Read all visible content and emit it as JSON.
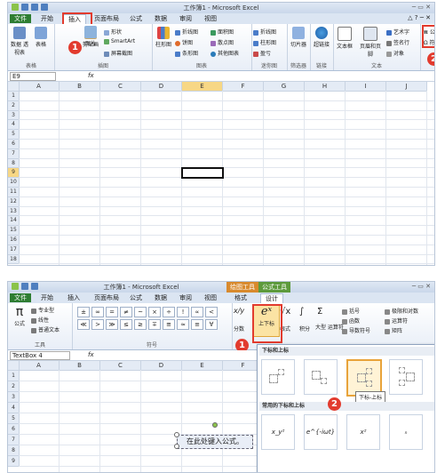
{
  "shot1": {
    "title": "工作簿1 - Microsoft Excel",
    "tabs": [
      "文件",
      "开始",
      "插入",
      "页面布局",
      "公式",
      "数据",
      "审阅",
      "视图"
    ],
    "groups": {
      "tables": {
        "label": "表格",
        "pivot": "数据\n透视表",
        "table": "表格"
      },
      "illustrations": {
        "label": "插图",
        "picture": "图片",
        "clipart": "剪贴画",
        "shapes": "形状",
        "smartart": "SmartArt",
        "screenshot": "屏幕截图"
      },
      "charts": {
        "label": "图表",
        "column": "柱形图",
        "line": "折线图",
        "pie": "饼图",
        "bar": "条形图",
        "area": "面积图",
        "scatter": "散点图",
        "other": "其他图表"
      },
      "sparklines": {
        "label": "迷你图",
        "line": "折线图",
        "column": "柱形图",
        "winloss": "盈亏"
      },
      "filter": {
        "label": "筛选器",
        "slicer": "切片器"
      },
      "links": {
        "label": "链接",
        "hyperlink": "超链接"
      },
      "text": {
        "label": "文本",
        "textbox": "文本框",
        "headerfooter": "页眉和页脚",
        "wordart": "艺术字",
        "signature": "签名行",
        "object": "对象"
      },
      "symbols": {
        "equation": "公式",
        "symbol": "符号"
      }
    },
    "namebox": "E9",
    "fx": "fx",
    "columns": [
      "A",
      "B",
      "C",
      "D",
      "E",
      "F",
      "G",
      "H",
      "I",
      "J"
    ],
    "rows": [
      "1",
      "2",
      "3",
      "4",
      "5",
      "6",
      "7",
      "8",
      "9",
      "10",
      "11",
      "12",
      "13",
      "14",
      "15",
      "16",
      "17",
      "18"
    ],
    "badge1": "1",
    "badge2": "2"
  },
  "shot2": {
    "title": "工作簿1 - Microsoft Excel",
    "context_tabs": {
      "drawing": "绘图工具",
      "equation": "公式工具"
    },
    "tabs": [
      "文件",
      "开始",
      "插入",
      "页面布局",
      "公式",
      "数据",
      "审阅",
      "视图",
      "格式",
      "设计"
    ],
    "tools": {
      "label": "工具",
      "equation": "公式",
      "professional": "专业型",
      "linear": "线性",
      "normal_text": "普通文本"
    },
    "symbols_label": "符号",
    "symbols": [
      "±",
      "∞",
      "=",
      "≠",
      "~",
      "×",
      "÷",
      "!",
      "∝",
      "<",
      "≪",
      ">",
      "≫",
      "≤",
      "≥",
      "∓",
      "≅",
      "≈",
      "≡",
      "∀"
    ],
    "structures": {
      "fraction": "分数",
      "script": "上下标",
      "radical": "根式",
      "integral": "积分",
      "large_operator": "大型\n运算符",
      "bracket": "括号",
      "function": "函数",
      "accent": "导数符号",
      "limit": "极限和对数",
      "operator": "运算符",
      "matrix": "矩阵"
    },
    "namebox": "TextBox 4",
    "fx": "fx",
    "columns": [
      "A",
      "B",
      "C",
      "D",
      "E",
      "F"
    ],
    "rows": [
      "1",
      "2",
      "3",
      "4",
      "5",
      "6",
      "7",
      "8",
      "9"
    ],
    "dropdown": {
      "section1": "下标和上标",
      "section2": "常用的下标和上标",
      "tooltip": "下标-上标",
      "common": [
        "x_y²",
        "e^{-iωt}",
        "x²",
        "ₙ"
      ]
    },
    "textbox_text": "在此处键入公式。",
    "badge1": "1",
    "badge2": "2"
  }
}
